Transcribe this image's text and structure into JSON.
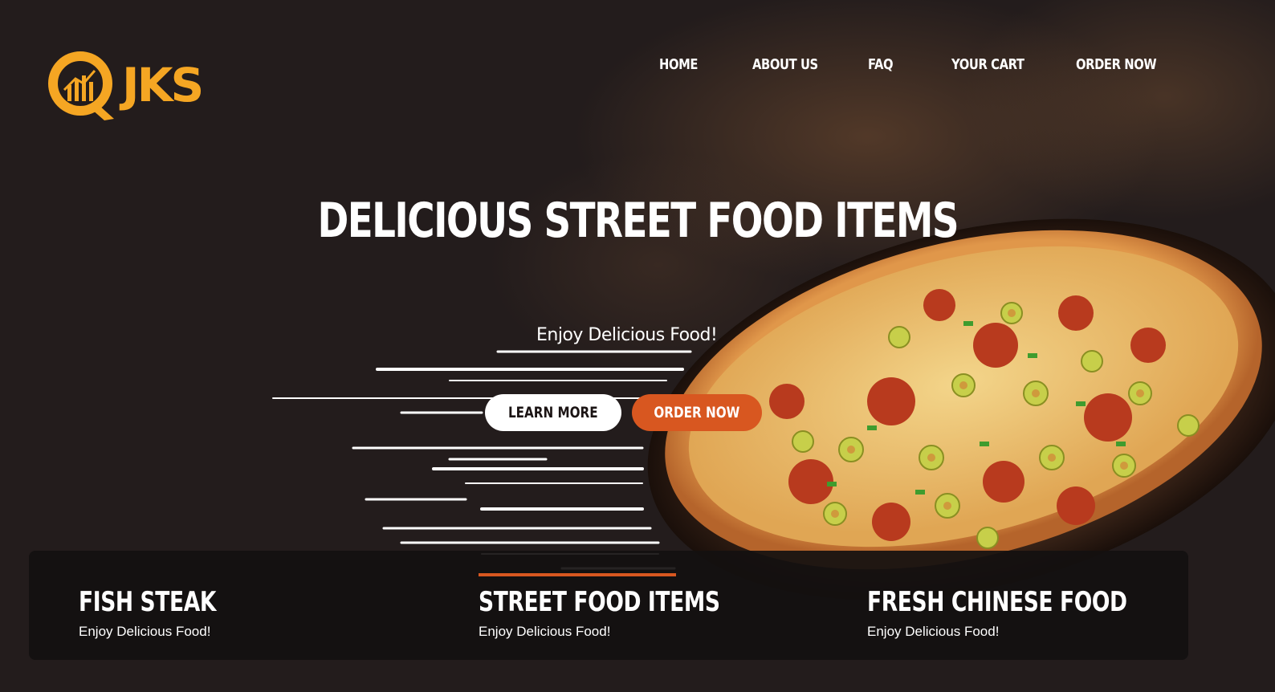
{
  "brand": {
    "logo_text": "JKS",
    "accent": "#f5a623"
  },
  "nav": {
    "items": [
      {
        "label": "HOME"
      },
      {
        "label": "ABOUT US"
      },
      {
        "label": "FAQ"
      },
      {
        "label": "YOUR CART"
      },
      {
        "label": "ORDER NOW"
      }
    ]
  },
  "hero": {
    "title": "DELICIOUS STREET FOOD ITEMS",
    "tagline": "Enjoy Delicious Food!",
    "learn_more_label": "LEARN MORE",
    "order_now_label": "ORDER NOW",
    "order_color": "#d85720"
  },
  "features": [
    {
      "title": "FISH STEAK",
      "subtitle": "Enjoy Delicious Food!",
      "active": false
    },
    {
      "title": "STREET FOOD ITEMS",
      "subtitle": "Enjoy Delicious Food!",
      "active": true
    },
    {
      "title": "FRESH CHINESE FOOD",
      "subtitle": "Enjoy Delicious Food!",
      "active": false
    }
  ]
}
